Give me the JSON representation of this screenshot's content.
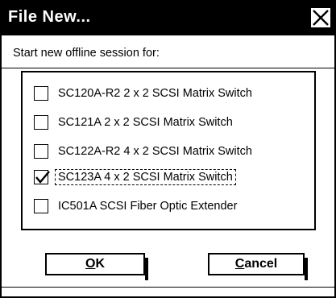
{
  "window": {
    "title": "File New..."
  },
  "prompt": "Start new offline session for:",
  "options": [
    {
      "label": "SC120A-R2 2 x 2 SCSI Matrix Switch",
      "checked": false
    },
    {
      "label": "SC121A 2 x 2 SCSI Matrix Switch",
      "checked": false
    },
    {
      "label": "SC122A-R2 4 x 2 SCSI Matrix Switch",
      "checked": false
    },
    {
      "label": "SC123A 4 x 2 SCSI Matrix Switch",
      "checked": true
    },
    {
      "label": "IC501A SCSI Fiber Optic Extender",
      "checked": false
    }
  ],
  "buttons": {
    "ok": {
      "accel": "O",
      "rest": "K"
    },
    "cancel": {
      "accel": "C",
      "rest": "ancel"
    }
  },
  "icons": {
    "close": "close-icon",
    "check": "checkmark-icon"
  }
}
